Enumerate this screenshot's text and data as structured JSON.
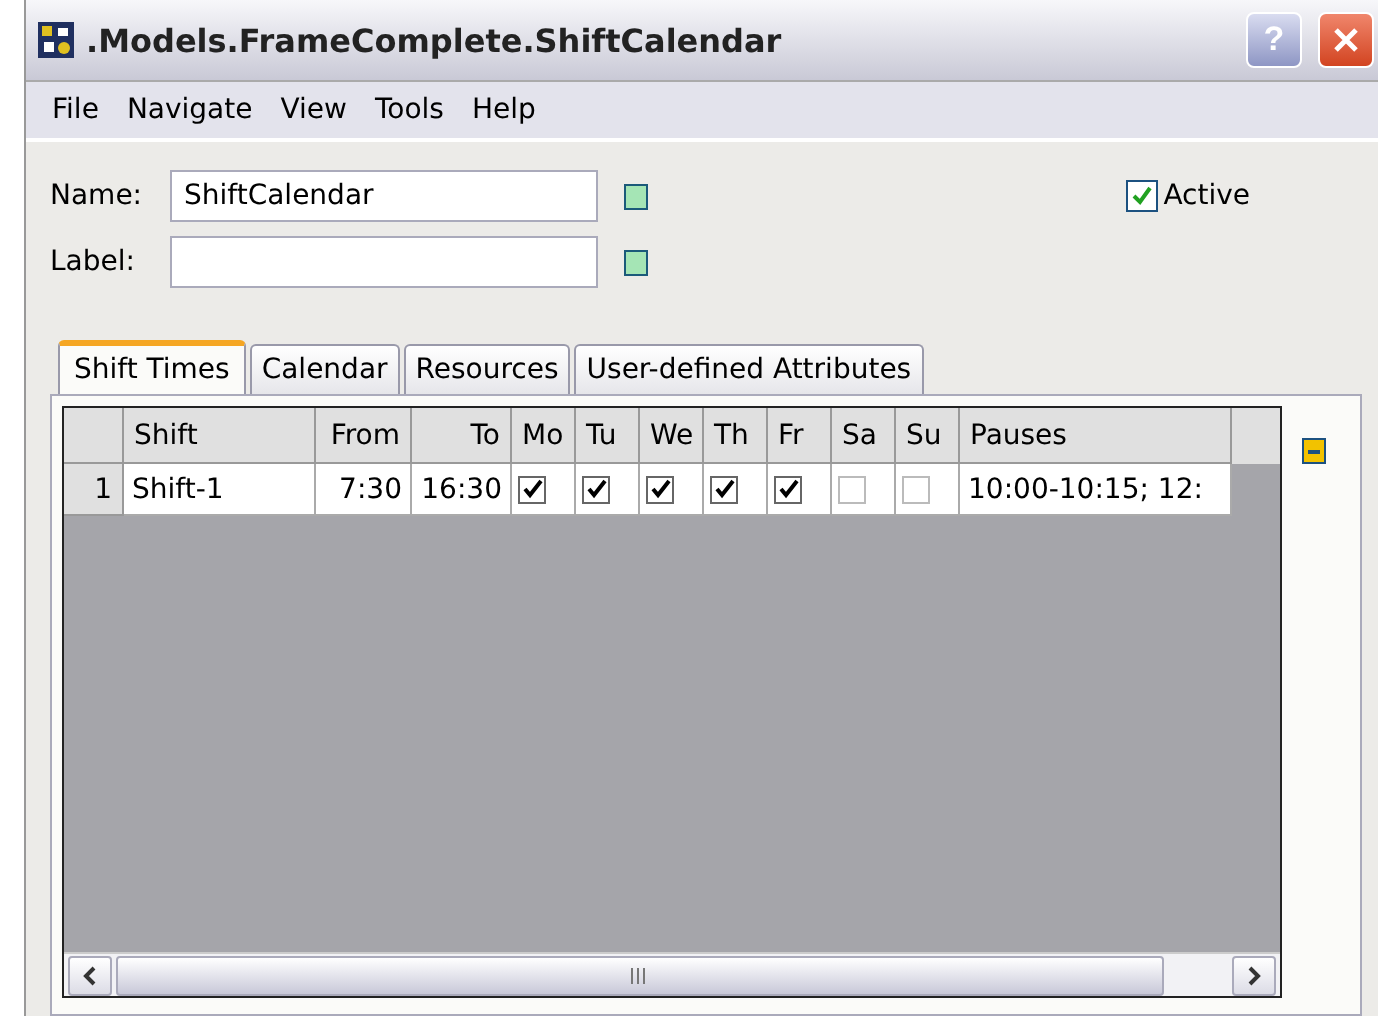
{
  "window": {
    "title": ".Models.FrameComplete.ShiftCalendar",
    "help_glyph": "?"
  },
  "menu": [
    "File",
    "Navigate",
    "View",
    "Tools",
    "Help"
  ],
  "name_field": {
    "label": "Name:",
    "value": "ShiftCalendar"
  },
  "label_field": {
    "label": "Label:"
  },
  "active": {
    "label": "Active",
    "checked": true
  },
  "tabs": [
    {
      "label": "Shift Times",
      "selected": true
    },
    {
      "label": "Calendar",
      "selected": false
    },
    {
      "label": "Resources",
      "selected": false
    },
    {
      "label": "User-defined Attributes",
      "selected": false
    }
  ],
  "table": {
    "columns": [
      {
        "label": "Shift"
      },
      {
        "label": "From"
      },
      {
        "label": "To"
      },
      {
        "label": "Mo"
      },
      {
        "label": "Tu"
      },
      {
        "label": "We"
      },
      {
        "label": "Th"
      },
      {
        "label": "Fr"
      },
      {
        "label": "Sa"
      },
      {
        "label": "Su"
      },
      {
        "label": "Pauses"
      }
    ],
    "rows": [
      {
        "number": "1",
        "shift": "Shift-1",
        "from": "7:30",
        "to": "16:30",
        "days": [
          true,
          true,
          true,
          true,
          true,
          false,
          false
        ],
        "pauses": "10:00-10:15; 12:"
      }
    ]
  }
}
